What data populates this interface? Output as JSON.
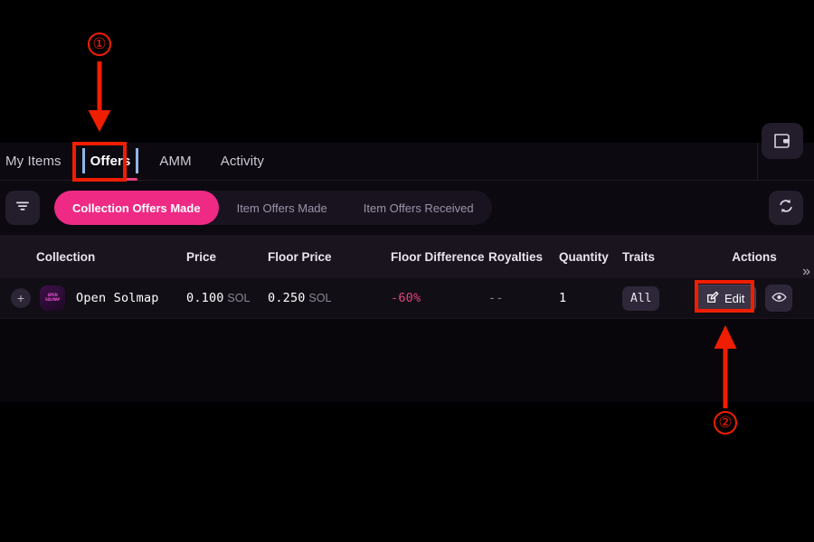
{
  "tabs": [
    {
      "label": "My Items",
      "active": false
    },
    {
      "label": "Offers",
      "active": true
    },
    {
      "label": "AMM",
      "active": false
    },
    {
      "label": "Activity",
      "active": false
    }
  ],
  "toolbar": {
    "filter_icon": "filter-icon",
    "refresh_icon": "refresh-icon",
    "wallet_icon": "wallet-icon",
    "segments": [
      {
        "label": "Collection Offers Made",
        "active": true
      },
      {
        "label": "Item Offers Made",
        "active": false
      },
      {
        "label": "Item Offers Received",
        "active": false
      }
    ]
  },
  "table": {
    "columns": [
      "Collection",
      "Price",
      "Floor Price",
      "Floor Difference",
      "Royalties",
      "Quantity",
      "Traits",
      "Actions"
    ],
    "expand_chevron": "»",
    "rows": [
      {
        "add_label": "+",
        "thumb_text": "OPEN\nSOLMAP",
        "collection": "Open Solmap",
        "price_value": "0.100",
        "price_unit": "SOL",
        "floor_value": "0.250",
        "floor_unit": "SOL",
        "floor_difference": "-60%",
        "royalties": "--",
        "quantity": "1",
        "traits": "All",
        "edit_label": "Edit",
        "edit_icon": "pencil-square-icon",
        "view_icon": "eye-icon"
      }
    ]
  },
  "annotations": [
    {
      "marker": "①",
      "target": "Offers tab"
    },
    {
      "marker": "②",
      "target": "Edit button"
    }
  ],
  "colors": {
    "accent_pink": "#ee2a85",
    "negative": "#e8407f",
    "annotation_red": "#f01e00",
    "panel_bg": "#0c0910",
    "header_row_bg": "#1a141f",
    "row_bg": "#120e16"
  }
}
